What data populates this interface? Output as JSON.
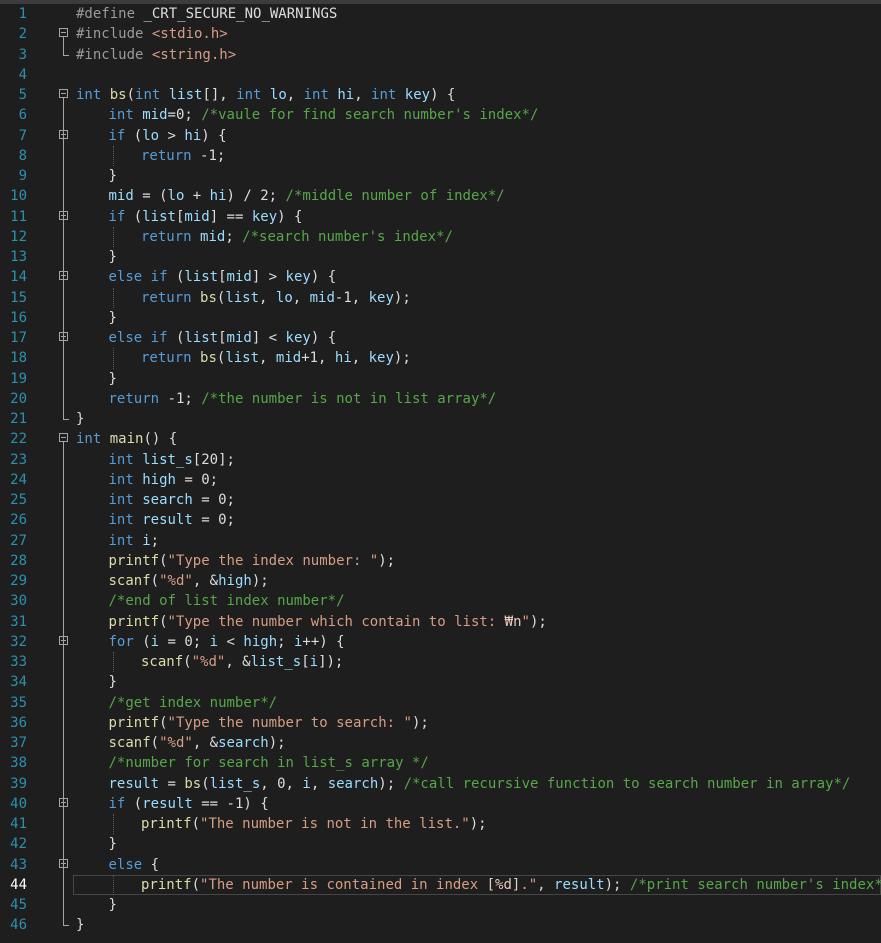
{
  "editor": {
    "current_line": 44,
    "lines": [
      {
        "n": 1,
        "indent": 0,
        "tokens": [
          [
            "pp",
            "#define "
          ],
          [
            "pl",
            "_CRT_SECURE_NO_WARNINGS"
          ]
        ]
      },
      {
        "n": 2,
        "indent": 0,
        "tokens": [
          [
            "pp",
            "#include "
          ],
          [
            "str",
            "<stdio.h>"
          ]
        ]
      },
      {
        "n": 3,
        "indent": 0,
        "tokens": [
          [
            "pp",
            "#include "
          ],
          [
            "str",
            "<string.h>"
          ]
        ]
      },
      {
        "n": 4,
        "indent": 0,
        "tokens": []
      },
      {
        "n": 5,
        "indent": 0,
        "tokens": [
          [
            "kw",
            "int "
          ],
          [
            "fn",
            "bs"
          ],
          [
            "pl",
            "("
          ],
          [
            "kw",
            "int "
          ],
          [
            "var",
            "list"
          ],
          [
            "pl",
            "[], "
          ],
          [
            "kw",
            "int "
          ],
          [
            "var",
            "lo"
          ],
          [
            "pl",
            ", "
          ],
          [
            "kw",
            "int "
          ],
          [
            "var",
            "hi"
          ],
          [
            "pl",
            ", "
          ],
          [
            "kw",
            "int "
          ],
          [
            "var",
            "key"
          ],
          [
            "pl",
            ") {"
          ]
        ]
      },
      {
        "n": 6,
        "indent": 1,
        "tokens": [
          [
            "kw",
            "int "
          ],
          [
            "var",
            "mid"
          ],
          [
            "pl",
            "=0; "
          ],
          [
            "cm",
            "/*vaule for find search number's index*/"
          ]
        ]
      },
      {
        "n": 7,
        "indent": 1,
        "tokens": [
          [
            "kw",
            "if "
          ],
          [
            "pl",
            "("
          ],
          [
            "var",
            "lo"
          ],
          [
            "pl",
            " > "
          ],
          [
            "var",
            "hi"
          ],
          [
            "pl",
            ") {"
          ]
        ]
      },
      {
        "n": 8,
        "indent": 2,
        "tokens": [
          [
            "kw",
            "return "
          ],
          [
            "pl",
            "-1;"
          ]
        ]
      },
      {
        "n": 9,
        "indent": 1,
        "tokens": [
          [
            "pl",
            "}"
          ]
        ]
      },
      {
        "n": 10,
        "indent": 1,
        "tokens": [
          [
            "var",
            "mid"
          ],
          [
            "pl",
            " = ("
          ],
          [
            "var",
            "lo"
          ],
          [
            "pl",
            " + "
          ],
          [
            "var",
            "hi"
          ],
          [
            "pl",
            ") / 2; "
          ],
          [
            "cm",
            "/*middle number of index*/"
          ]
        ]
      },
      {
        "n": 11,
        "indent": 1,
        "tokens": [
          [
            "kw",
            "if "
          ],
          [
            "pl",
            "("
          ],
          [
            "var",
            "list"
          ],
          [
            "pl",
            "["
          ],
          [
            "var",
            "mid"
          ],
          [
            "pl",
            "] == "
          ],
          [
            "var",
            "key"
          ],
          [
            "pl",
            ") {"
          ]
        ]
      },
      {
        "n": 12,
        "indent": 2,
        "tokens": [
          [
            "kw",
            "return "
          ],
          [
            "var",
            "mid"
          ],
          [
            "pl",
            "; "
          ],
          [
            "cm",
            "/*search number's index*/"
          ]
        ]
      },
      {
        "n": 13,
        "indent": 1,
        "tokens": [
          [
            "pl",
            "}"
          ]
        ]
      },
      {
        "n": 14,
        "indent": 1,
        "tokens": [
          [
            "kw",
            "else if "
          ],
          [
            "pl",
            "("
          ],
          [
            "var",
            "list"
          ],
          [
            "pl",
            "["
          ],
          [
            "var",
            "mid"
          ],
          [
            "pl",
            "] > "
          ],
          [
            "var",
            "key"
          ],
          [
            "pl",
            ") {"
          ]
        ]
      },
      {
        "n": 15,
        "indent": 2,
        "tokens": [
          [
            "kw",
            "return "
          ],
          [
            "fn",
            "bs"
          ],
          [
            "pl",
            "("
          ],
          [
            "var",
            "list"
          ],
          [
            "pl",
            ", "
          ],
          [
            "var",
            "lo"
          ],
          [
            "pl",
            ", "
          ],
          [
            "var",
            "mid"
          ],
          [
            "pl",
            "-1, "
          ],
          [
            "var",
            "key"
          ],
          [
            "pl",
            ");"
          ]
        ]
      },
      {
        "n": 16,
        "indent": 1,
        "tokens": [
          [
            "pl",
            "}"
          ]
        ]
      },
      {
        "n": 17,
        "indent": 1,
        "tokens": [
          [
            "kw",
            "else if "
          ],
          [
            "pl",
            "("
          ],
          [
            "var",
            "list"
          ],
          [
            "pl",
            "["
          ],
          [
            "var",
            "mid"
          ],
          [
            "pl",
            "] < "
          ],
          [
            "var",
            "key"
          ],
          [
            "pl",
            ") {"
          ]
        ]
      },
      {
        "n": 18,
        "indent": 2,
        "tokens": [
          [
            "kw",
            "return "
          ],
          [
            "fn",
            "bs"
          ],
          [
            "pl",
            "("
          ],
          [
            "var",
            "list"
          ],
          [
            "pl",
            ", "
          ],
          [
            "var",
            "mid"
          ],
          [
            "pl",
            "+1, "
          ],
          [
            "var",
            "hi"
          ],
          [
            "pl",
            ", "
          ],
          [
            "var",
            "key"
          ],
          [
            "pl",
            ");"
          ]
        ]
      },
      {
        "n": 19,
        "indent": 1,
        "tokens": [
          [
            "pl",
            "}"
          ]
        ]
      },
      {
        "n": 20,
        "indent": 1,
        "tokens": [
          [
            "kw",
            "return "
          ],
          [
            "pl",
            "-1; "
          ],
          [
            "cm",
            "/*the number is not in list array*/"
          ]
        ]
      },
      {
        "n": 21,
        "indent": 0,
        "tokens": [
          [
            "pl",
            "}"
          ]
        ]
      },
      {
        "n": 22,
        "indent": 0,
        "tokens": [
          [
            "kw",
            "int "
          ],
          [
            "fn",
            "main"
          ],
          [
            "pl",
            "() {"
          ]
        ]
      },
      {
        "n": 23,
        "indent": 1,
        "tokens": [
          [
            "kw",
            "int "
          ],
          [
            "var",
            "list_s"
          ],
          [
            "pl",
            "[20];"
          ]
        ]
      },
      {
        "n": 24,
        "indent": 1,
        "tokens": [
          [
            "kw",
            "int "
          ],
          [
            "var",
            "high"
          ],
          [
            "pl",
            " = 0;"
          ]
        ]
      },
      {
        "n": 25,
        "indent": 1,
        "tokens": [
          [
            "kw",
            "int "
          ],
          [
            "var",
            "search"
          ],
          [
            "pl",
            " = 0;"
          ]
        ]
      },
      {
        "n": 26,
        "indent": 1,
        "tokens": [
          [
            "kw",
            "int "
          ],
          [
            "var",
            "result"
          ],
          [
            "pl",
            " = 0;"
          ]
        ]
      },
      {
        "n": 27,
        "indent": 1,
        "tokens": [
          [
            "kw",
            "int "
          ],
          [
            "var",
            "i"
          ],
          [
            "pl",
            ";"
          ]
        ]
      },
      {
        "n": 28,
        "indent": 1,
        "tokens": [
          [
            "fn",
            "printf"
          ],
          [
            "pl",
            "("
          ],
          [
            "str",
            "\"Type the index number: \""
          ],
          [
            "pl",
            ");"
          ]
        ]
      },
      {
        "n": 29,
        "indent": 1,
        "tokens": [
          [
            "fn",
            "scanf"
          ],
          [
            "pl",
            "("
          ],
          [
            "str",
            "\"%d\""
          ],
          [
            "pl",
            ", &"
          ],
          [
            "var",
            "high"
          ],
          [
            "pl",
            ");"
          ]
        ]
      },
      {
        "n": 30,
        "indent": 1,
        "tokens": [
          [
            "cm",
            "/*end of list index number*/"
          ]
        ]
      },
      {
        "n": 31,
        "indent": 1,
        "tokens": [
          [
            "fn",
            "printf"
          ],
          [
            "pl",
            "("
          ],
          [
            "str",
            "\"Type the number which contain to list: "
          ],
          [
            "esc",
            "₩n"
          ],
          [
            "str",
            "\""
          ],
          [
            "pl",
            ");"
          ]
        ]
      },
      {
        "n": 32,
        "indent": 1,
        "tokens": [
          [
            "kw",
            "for "
          ],
          [
            "pl",
            "("
          ],
          [
            "var",
            "i"
          ],
          [
            "pl",
            " = 0; "
          ],
          [
            "var",
            "i"
          ],
          [
            "pl",
            " < "
          ],
          [
            "var",
            "high"
          ],
          [
            "pl",
            "; "
          ],
          [
            "var",
            "i"
          ],
          [
            "pl",
            "++) {"
          ]
        ]
      },
      {
        "n": 33,
        "indent": 2,
        "tokens": [
          [
            "fn",
            "scanf"
          ],
          [
            "pl",
            "("
          ],
          [
            "str",
            "\"%d\""
          ],
          [
            "pl",
            ", &"
          ],
          [
            "var",
            "list_s"
          ],
          [
            "pl",
            "["
          ],
          [
            "var",
            "i"
          ],
          [
            "pl",
            "]);"
          ]
        ]
      },
      {
        "n": 34,
        "indent": 1,
        "tokens": [
          [
            "pl",
            "}"
          ]
        ]
      },
      {
        "n": 35,
        "indent": 1,
        "tokens": [
          [
            "cm",
            "/*get index number*/"
          ]
        ]
      },
      {
        "n": 36,
        "indent": 1,
        "tokens": [
          [
            "fn",
            "printf"
          ],
          [
            "pl",
            "("
          ],
          [
            "str",
            "\"Type the number to search: \""
          ],
          [
            "pl",
            ");"
          ]
        ]
      },
      {
        "n": 37,
        "indent": 1,
        "tokens": [
          [
            "fn",
            "scanf"
          ],
          [
            "pl",
            "("
          ],
          [
            "str",
            "\"%d\""
          ],
          [
            "pl",
            ", &"
          ],
          [
            "var",
            "search"
          ],
          [
            "pl",
            ");"
          ]
        ]
      },
      {
        "n": 38,
        "indent": 1,
        "tokens": [
          [
            "cm",
            "/*number for search in list_s array */"
          ]
        ]
      },
      {
        "n": 39,
        "indent": 1,
        "tokens": [
          [
            "var",
            "result"
          ],
          [
            "pl",
            " = "
          ],
          [
            "fn",
            "bs"
          ],
          [
            "pl",
            "("
          ],
          [
            "var",
            "list_s"
          ],
          [
            "pl",
            ", 0, "
          ],
          [
            "var",
            "i"
          ],
          [
            "pl",
            ", "
          ],
          [
            "var",
            "search"
          ],
          [
            "pl",
            "); "
          ],
          [
            "cm",
            "/*call recursive function to search number in array*/"
          ]
        ]
      },
      {
        "n": 40,
        "indent": 1,
        "tokens": [
          [
            "kw",
            "if "
          ],
          [
            "pl",
            "("
          ],
          [
            "var",
            "result"
          ],
          [
            "pl",
            " == -1) {"
          ]
        ]
      },
      {
        "n": 41,
        "indent": 2,
        "tokens": [
          [
            "fn",
            "printf"
          ],
          [
            "pl",
            "("
          ],
          [
            "str",
            "\"The number is not in the list.\""
          ],
          [
            "pl",
            ");"
          ]
        ]
      },
      {
        "n": 42,
        "indent": 1,
        "tokens": [
          [
            "pl",
            "}"
          ]
        ]
      },
      {
        "n": 43,
        "indent": 1,
        "tokens": [
          [
            "kw",
            "else "
          ],
          [
            "pl",
            "{"
          ]
        ]
      },
      {
        "n": 44,
        "indent": 2,
        "tokens": [
          [
            "fn",
            "printf"
          ],
          [
            "pl",
            "("
          ],
          [
            "str",
            "\"The number is contained in index "
          ],
          [
            "esc",
            "[%d]"
          ],
          [
            "str",
            ".\""
          ],
          [
            "pl",
            ", "
          ],
          [
            "var",
            "result"
          ],
          [
            "pl",
            "); "
          ],
          [
            "cm",
            "/*print search number's index*/"
          ]
        ]
      },
      {
        "n": 45,
        "indent": 1,
        "tokens": [
          [
            "pl",
            "}"
          ]
        ]
      },
      {
        "n": 46,
        "indent": 0,
        "tokens": [
          [
            "pl",
            "}"
          ]
        ]
      }
    ]
  }
}
